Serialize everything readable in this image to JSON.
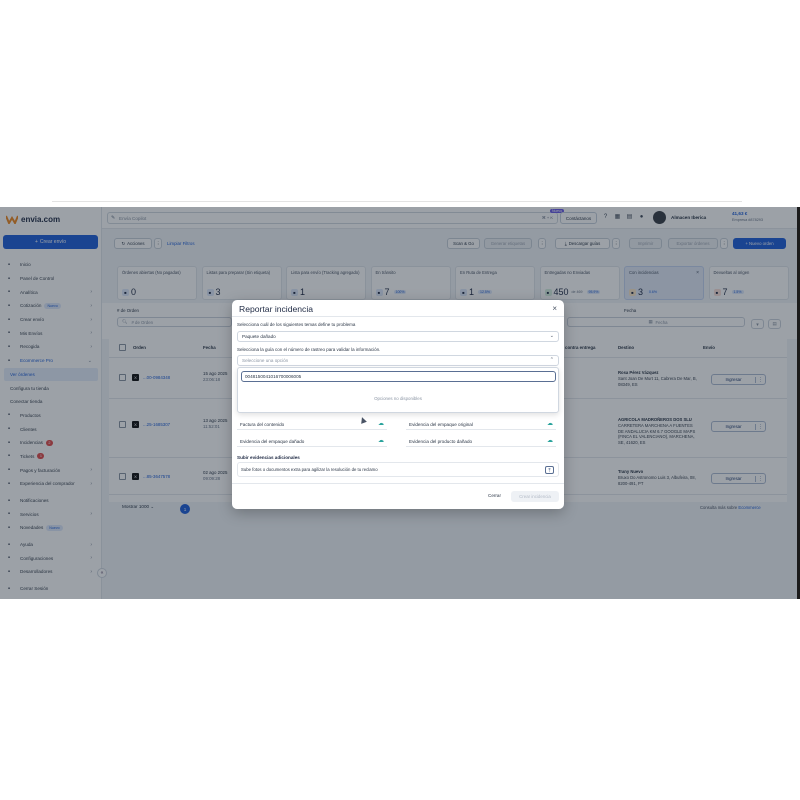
{
  "app": {
    "logo": "envia.com"
  },
  "sidebar": {
    "create_button": "Crear envío",
    "items": [
      {
        "label": "Inicio",
        "icon": "home-icon",
        "chev": ""
      },
      {
        "label": "Panel de Control",
        "icon": "dashboard-icon",
        "chev": ""
      },
      {
        "label": "Analítica",
        "icon": "chart-icon",
        "chev": "›"
      },
      {
        "label": "Cotización",
        "icon": "calculator-icon",
        "chev": "›",
        "pill": "Nuevo"
      },
      {
        "label": "Crear envío",
        "icon": "truck-icon",
        "chev": "›"
      },
      {
        "label": "Mis Envíos",
        "icon": "box-icon",
        "chev": "›"
      },
      {
        "label": "Recogida",
        "icon": "pickup-icon",
        "chev": "›"
      },
      {
        "label": "Ecommerce Pro",
        "icon": "store-icon",
        "chev": "⌄",
        "active": true
      },
      {
        "label": "Ver órdenes",
        "sub": "active"
      },
      {
        "label": "Configura tu tienda",
        "sub": "plain"
      },
      {
        "label": "Conectar tienda",
        "sub": "plain"
      },
      {
        "label": "Productos",
        "icon": "tag-icon",
        "chev": ""
      },
      {
        "label": "Clientes",
        "icon": "users-icon",
        "chev": ""
      },
      {
        "label": "Incidencias",
        "icon": "alert-icon",
        "chev": "",
        "count": "2"
      },
      {
        "label": "Tickets",
        "icon": "ticket-icon",
        "chev": "",
        "count": "1"
      },
      {
        "label": "Pagos y facturación",
        "icon": "payment-icon",
        "chev": "›"
      },
      {
        "label": "Experiencia del comprador",
        "icon": "star-icon",
        "chev": "›"
      },
      {
        "label": "Notificaciones",
        "icon": "bell-icon",
        "chev": ""
      },
      {
        "label": "Servicios",
        "icon": "services-icon",
        "chev": "›"
      },
      {
        "label": "Novedades",
        "icon": "news-icon",
        "chev": "",
        "pill": "Nuevo"
      },
      {
        "label": "Ayuda",
        "icon": "help-icon",
        "chev": "›"
      },
      {
        "label": "Configuraciones",
        "icon": "settings-icon",
        "chev": "›"
      },
      {
        "label": "Desarrolladores",
        "icon": "code-icon",
        "chev": "›"
      },
      {
        "label": "Cerrar Sesión",
        "icon": "logout-icon",
        "chev": ""
      }
    ]
  },
  "topbar": {
    "search_placeholder": "Envía Copilot",
    "shortcut": "⌘ + K",
    "new_tag": "Nuevo",
    "contact": "Contáctanos",
    "store": "Almacen Iberica",
    "balance": "41,63 €",
    "company": "Empresa #878293"
  },
  "toolbar": {
    "actions": "Acciones",
    "clear": "Limpiar Filtros",
    "scan": "Scan & Go",
    "disabled1": "Generar etiquetas",
    "download": "Descargar guías",
    "disabled2": "Imprimir",
    "disabled3": "Exportar órdenes",
    "new_order": "+ Nuevo orden"
  },
  "cards": [
    {
      "title": "Órdenes abiertas (No pagadas)",
      "value": "0",
      "icon": "open-orders-icon",
      "color": "#dfe9fb"
    },
    {
      "title": "Listas para preparar (Sin etiqueta)",
      "value": "3",
      "icon": "prepare-icon",
      "color": "#dfe9fb"
    },
    {
      "title": "Lista para envío (Tracking agregado)",
      "value": "1",
      "icon": "tracking-icon",
      "color": "#dfe9fb"
    },
    {
      "title": "En tránsito",
      "value": "7",
      "icon": "transit-icon",
      "color": "#dfe9fb",
      "tag": "100%"
    },
    {
      "title": "En Ruta de Entrega",
      "value": "1",
      "icon": "route-icon",
      "color": "#dfe9fb",
      "tag": "12.5%"
    },
    {
      "title": "Entregadas no Enviadas",
      "value": "450",
      "icon": "delivered-icon",
      "color": "#d8f0e1",
      "small": "de 469",
      "tag": "95.9%"
    },
    {
      "title": "Con incidencias",
      "value": "3",
      "icon": "incident-icon",
      "color": "#fbe7c9",
      "tag": "0.6%",
      "selected": true
    },
    {
      "title": "Devueltas al origen",
      "value": "7",
      "icon": "return-icon",
      "color": "#fbe1d8",
      "tag": "1.5%"
    }
  ],
  "filters": {
    "order_label": "# de Orden",
    "order_placeholder": "# de Orden",
    "date_label": "Fecha",
    "date_placeholder": "Fecha"
  },
  "table": {
    "headers": {
      "order": "Orden",
      "date": "Fecha",
      "delivery": "contra entrega",
      "dest": "Destino",
      "shipping": "Envío"
    },
    "rows": [
      {
        "order": "...00-0984348",
        "carrier": "X",
        "date": "15 ago 2025",
        "time": "23:06:18",
        "name": "Rosa Pérez Vázquez",
        "addr": "Sant Joan De Murt 11, Cabrera De Mar, B, 08349, ES",
        "action": "Ingresar"
      },
      {
        "order": "...25-1685307",
        "carrier": "X",
        "date": "13 ago 2025",
        "time": "11:52:01",
        "name": "AGRICOLA MADROÑEROS DOS SLU",
        "addr": "CARRETERA MARCHENA A FUENTES DE ANDALUCIA KM 6.7 GOOGLE MAPS (FINCA EL VALENCIANO), MARCHENA, SE, 41620, ES",
        "action": "Ingresar"
      },
      {
        "order": "...85-3647578",
        "carrier": "X",
        "date": "02 ago 2025",
        "time": "09:09:28",
        "name": "Trany Nuevo",
        "addr": "Bruxo Do Astronomo Luis 3, Albufeira, 08, 8200-491, PT",
        "action": "Ingresar"
      }
    ]
  },
  "pagination": {
    "per_page": "Mostrar 1000",
    "page": "1"
  },
  "footer_note": {
    "prefix": "Consulta más sobre",
    "link": "Ecommerce"
  },
  "modal": {
    "title": "Reportar incidencia",
    "q1": "Selecciona cuál de los siguientes temas define tu problema",
    "q1_value": "Paquete dañado",
    "q2": "Selecciona la guía con el número de rastreo para validar la información.",
    "q2_placeholder": "Seleccione una opción",
    "search_value": "0048150041016700006005",
    "empty": "Opciones no disponibles",
    "evidence": [
      "Factura del contenido",
      "Evidencia del empaque original",
      "Evidencia del empaque dañado",
      "Evidencia del producto dañado"
    ],
    "section": "Subir evidencias adicionales",
    "upload_text": "Sube fotos o documentos extra para agilizar la resolución de tu reclamo",
    "cancel": "Cerrar",
    "submit": "Crear incidencia"
  },
  "colors": {
    "accent": "#1f5fd9",
    "teal": "#2aa39c"
  }
}
